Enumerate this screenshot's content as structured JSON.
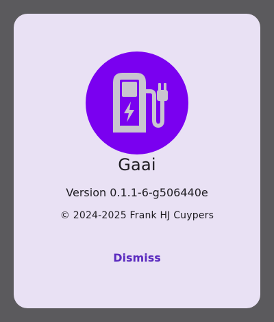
{
  "dialog": {
    "icon": "ev-charger-icon",
    "icon_colors": {
      "circle": "#7a00f0",
      "glyph": "#c9c5cf"
    },
    "app_name": "Gaai",
    "version": "Version 0.1.1-6-g506440e",
    "copyright": "© 2024-2025 Frank HJ Cuypers",
    "dismiss_label": "Dismiss"
  },
  "colors": {
    "scrim": "#5b5a5d",
    "dialog_bg": "#e9e1f4",
    "accent": "#5b2bbf"
  }
}
